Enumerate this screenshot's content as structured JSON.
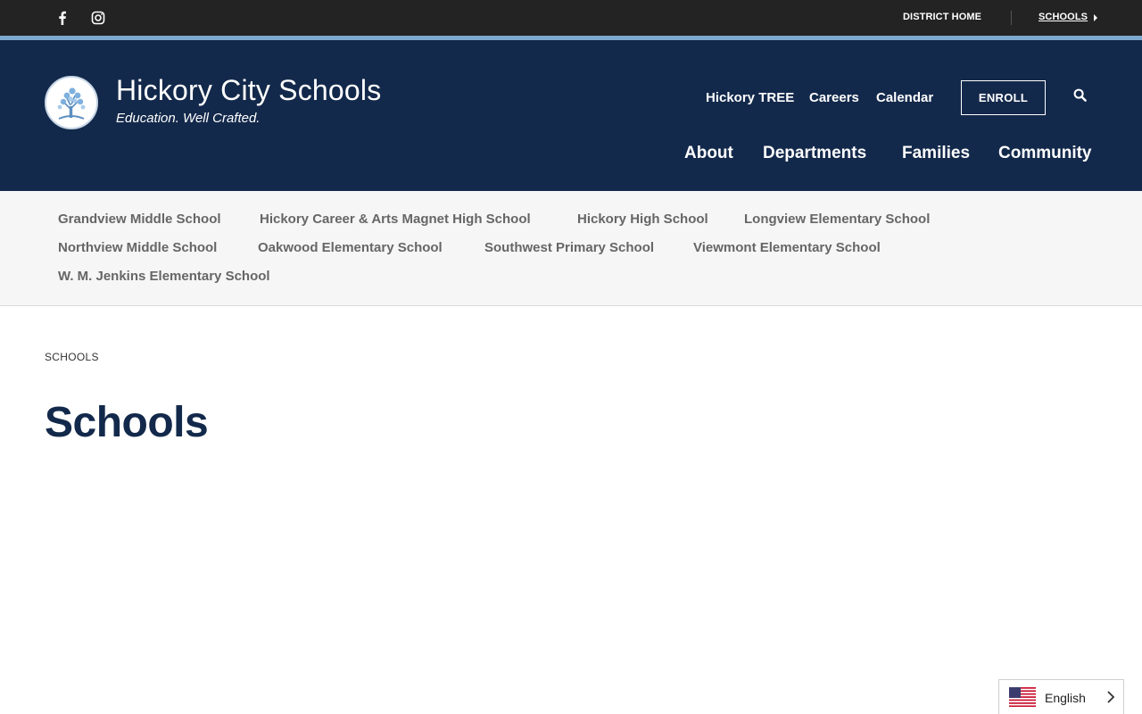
{
  "topbar": {
    "social": [
      {
        "icon": "facebook-icon"
      },
      {
        "icon": "instagram-icon"
      }
    ],
    "district_home": "DISTRICT HOME",
    "schools": "SCHOOLS"
  },
  "header": {
    "title": "Hickory City Schools",
    "tagline": "Education. Well Crafted.",
    "quick_links": [
      "Hickory TREE",
      "Careers",
      "Calendar"
    ],
    "enroll": "ENROLL",
    "main_nav": [
      "About",
      "Departments",
      "Families",
      "Community"
    ]
  },
  "schools_nav": [
    "Grandview Middle School",
    "Hickory Career & Arts Magnet High School",
    "Hickory High School",
    "Longview Elementary School",
    "Northview Middle School",
    "Oakwood Elementary School",
    "Southwest Primary School",
    "Viewmont Elementary School",
    "W. M. Jenkins Elementary School"
  ],
  "breadcrumb": "SCHOOLS",
  "page_title": "Schools",
  "language": {
    "label": "English"
  },
  "colors": {
    "topbar": "#232323",
    "accent": "#7ea9cf",
    "header": "#13294b",
    "subnav_bg": "#f6f6f6",
    "subnav_text": "#666666",
    "title": "#13294b"
  }
}
